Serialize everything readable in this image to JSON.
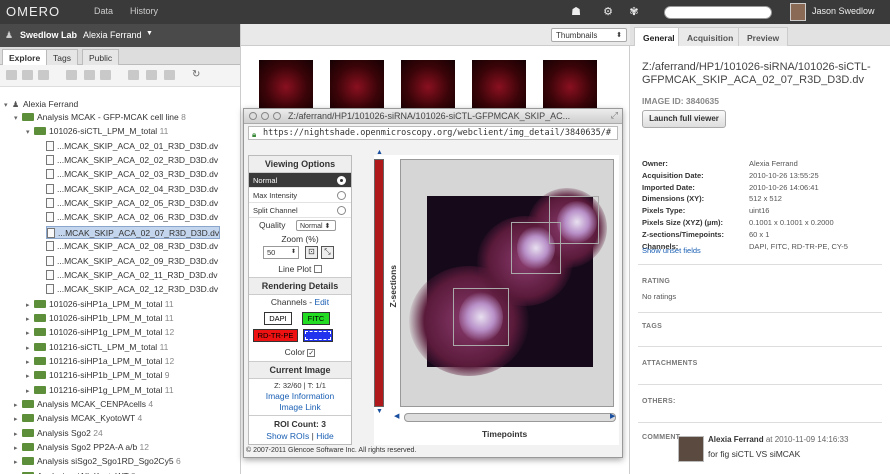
{
  "topbar": {
    "app_name": "OMERO",
    "nav": [
      "Data",
      "History"
    ],
    "user": "Jason Swedlow",
    "search_placeholder": ""
  },
  "groupbar": {
    "group": "Swedlow Lab",
    "user": "Alexia Ferrand"
  },
  "left_tabs": [
    "Explore",
    "Tags",
    "Public"
  ],
  "tree": {
    "root": "Alexia Ferrand",
    "nodes": [
      {
        "label": "Analysis MCAK - GFP-MCAK cell line",
        "count": "8",
        "kind": "folder",
        "level": 1,
        "open": true
      },
      {
        "label": "101026-siCTL_LPM_M_total",
        "count": "11",
        "kind": "folder",
        "level": 2,
        "open": true
      },
      {
        "label": "...MCAK_SKIP_ACA_02_01_R3D_D3D.dv",
        "kind": "image",
        "level": 3
      },
      {
        "label": "...MCAK_SKIP_ACA_02_02_R3D_D3D.dv",
        "kind": "image",
        "level": 3
      },
      {
        "label": "...MCAK_SKIP_ACA_02_03_R3D_D3D.dv",
        "kind": "image",
        "level": 3
      },
      {
        "label": "...MCAK_SKIP_ACA_02_04_R3D_D3D.dv",
        "kind": "image",
        "level": 3
      },
      {
        "label": "...MCAK_SKIP_ACA_02_05_R3D_D3D.dv",
        "kind": "image",
        "level": 3
      },
      {
        "label": "...MCAK_SKIP_ACA_02_06_R3D_D3D.dv",
        "kind": "image",
        "level": 3
      },
      {
        "label": "...MCAK_SKIP_ACA_02_07_R3D_D3D.dv",
        "kind": "image",
        "level": 3,
        "selected": true
      },
      {
        "label": "...MCAK_SKIP_ACA_02_08_R3D_D3D.dv",
        "kind": "image",
        "level": 3
      },
      {
        "label": "...MCAK_SKIP_ACA_02_09_R3D_D3D.dv",
        "kind": "image",
        "level": 3
      },
      {
        "label": "...MCAK_SKIP_ACA_02_11_R3D_D3D.dv",
        "kind": "image",
        "level": 3
      },
      {
        "label": "...MCAK_SKIP_ACA_02_12_R3D_D3D.dv",
        "kind": "image",
        "level": 3
      },
      {
        "label": "101026-siHP1a_LPM_M_total",
        "count": "11",
        "kind": "folder",
        "level": 2
      },
      {
        "label": "101026-siHP1b_LPM_M_total",
        "count": "11",
        "kind": "folder",
        "level": 2
      },
      {
        "label": "101026-siHP1g_LPM_M_total",
        "count": "12",
        "kind": "folder",
        "level": 2
      },
      {
        "label": "101216-siCTL_LPM_M_total",
        "count": "11",
        "kind": "folder",
        "level": 2
      },
      {
        "label": "101216-siHP1a_LPM_M_total",
        "count": "12",
        "kind": "folder",
        "level": 2
      },
      {
        "label": "101216-siHP1b_LPM_M_total",
        "count": "9",
        "kind": "folder",
        "level": 2
      },
      {
        "label": "101216-siHP1g_LPM_M_total",
        "count": "11",
        "kind": "folder",
        "level": 2
      },
      {
        "label": "Analysis MCAK_CENPAcells",
        "count": "4",
        "kind": "folder",
        "level": 1
      },
      {
        "label": "Analysis MCAK_KyotoWT",
        "count": "4",
        "kind": "folder",
        "level": 1
      },
      {
        "label": "Analysis Sgo2",
        "count": "24",
        "kind": "folder",
        "level": 1
      },
      {
        "label": "Analysis Sgo2 PP2A-A a/b",
        "count": "12",
        "kind": "folder",
        "level": 1
      },
      {
        "label": "Analysis siSgo2_Sgo1RD_Sgo2Cy5",
        "count": "6",
        "kind": "folder",
        "level": 1
      },
      {
        "label": "Analysis_siAll_KyotoWT",
        "count": "2",
        "kind": "folder",
        "level": 1
      }
    ]
  },
  "center": {
    "view_select": "Thumbnails"
  },
  "popup": {
    "title": "Z:/aferrand/HP1/101026-siRNA/101026-siCTL-GFPMCAK_SKIP_AC...",
    "url": "https://nightshade.openmicroscopy.org/webclient/img_detail/3840635/#",
    "viewing_options": "Viewing Options",
    "modes": [
      "Normal",
      "Max Intensity",
      "Split Channel"
    ],
    "quality_label": "Quality",
    "quality_value": "Normal",
    "zoom_label": "Zoom (%)",
    "zoom_value": "50",
    "line_plot": "Line Plot",
    "rendering_details": "Rendering Details",
    "channels_label": "Channels -",
    "edit": "Edit",
    "channels": [
      {
        "name": "DAPI",
        "color": "#ffffff"
      },
      {
        "name": "FITC",
        "color": "#22dd22"
      },
      {
        "name": "RD-TR-PE",
        "color": "#ee1111"
      },
      {
        "name": "CY-5",
        "color": "#2233ee"
      }
    ],
    "color_label": "Color",
    "current_image": "Current Image",
    "zt": "Z: 32/60 | T: 1/1",
    "image_information": "Image Information",
    "image_link": "Image Link",
    "roi_count": "ROI Count: 3",
    "show_rois": "Show ROIs",
    "hide": "Hide",
    "z_label": "Z-sections",
    "t_label": "Timepoints",
    "footer": "© 2007-2011 Glencoe Software Inc. All rights reserved."
  },
  "right": {
    "tabs": [
      "General",
      "Acquisition",
      "Preview"
    ],
    "path": "Z:/aferrand/HP1/101026-siRNA/101026-siCTL-GFPMCAK_SKIP_ACA_02_07_R3D_D3D.dv",
    "image_id": "IMAGE ID: 3840635",
    "full_viewer": "Launch full viewer",
    "meta": [
      {
        "k": "Owner:",
        "v": "Alexia Ferrand"
      },
      {
        "k": "Acquisition Date:",
        "v": "2010-10-26 13:55:25"
      },
      {
        "k": "Imported Date:",
        "v": "2010-10-26 14:06:41"
      },
      {
        "k": "Dimensions (XY):",
        "v": "512 x 512"
      },
      {
        "k": "Pixels Type:",
        "v": "uint16"
      },
      {
        "k": "Pixels Size (XYZ) (µm):",
        "v": "0.1001 x 0.1001 x 0.2000"
      },
      {
        "k": "Z-sections/Timepoints:",
        "v": "60 x 1"
      },
      {
        "k": "Channels:",
        "v": "DAPI, FITC, RD-TR-PE, CY-5"
      }
    ],
    "show_unset": "Show unset fields",
    "rating": "RATING",
    "no_ratings": "No ratings",
    "tags": "TAGS",
    "attachments": "ATTACHMENTS",
    "others": "OTHERS:",
    "comments": "COMMENT",
    "comment_author": "Alexia Ferrand",
    "comment_time": "at 2010-11-09 14:16:33",
    "comment_text": "for fig siCTL VS siMCAK"
  }
}
